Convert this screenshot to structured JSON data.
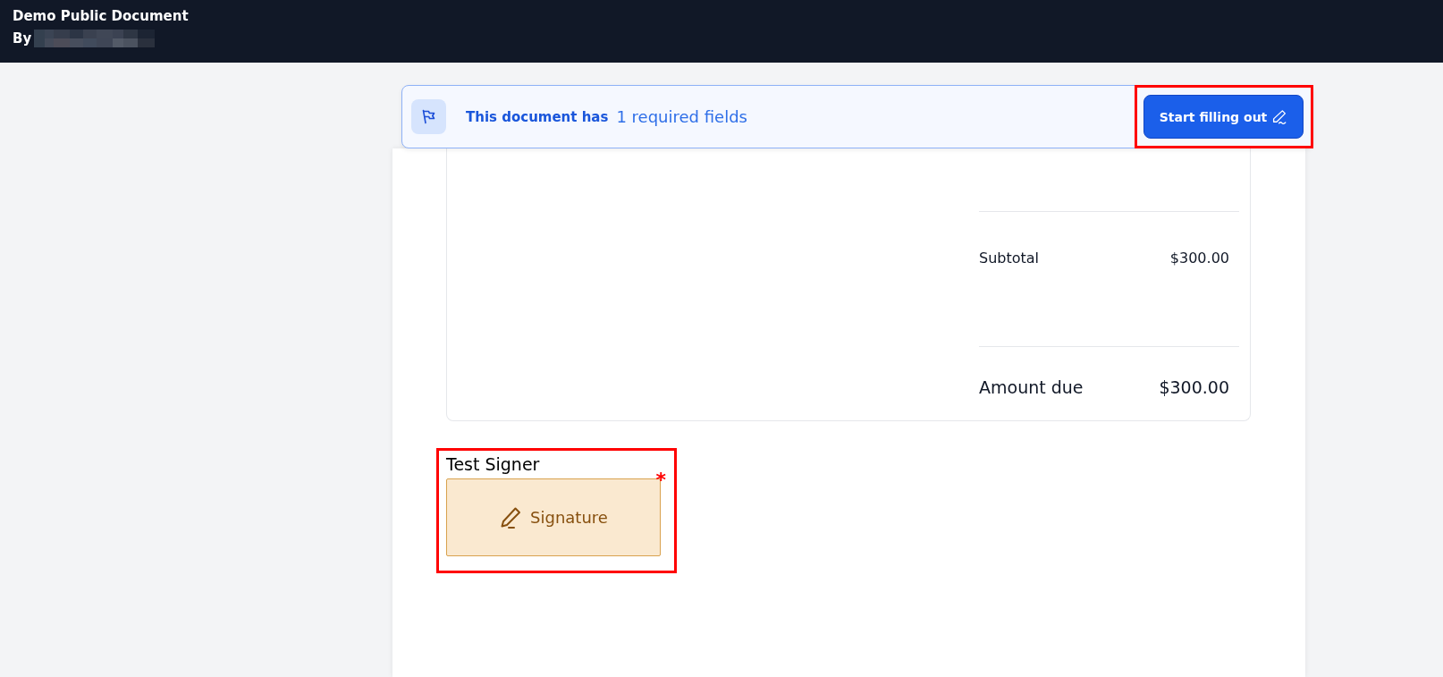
{
  "header": {
    "title": "Demo Public Document",
    "byline": "By"
  },
  "banner": {
    "message": "This document has",
    "required_fields": "1 required fields",
    "button": {
      "label": "Start filling out",
      "highlighted": true
    }
  },
  "totals": [
    {
      "kind": "subtotal",
      "label": "Subtotal",
      "value": "$300.00"
    },
    {
      "kind": "total",
      "label": "Amount due",
      "value": "$300.00"
    }
  ],
  "signature_field": {
    "signer": "Test Signer",
    "label": "Signature",
    "required": true,
    "required_mark": "*",
    "highlighted": true
  }
}
